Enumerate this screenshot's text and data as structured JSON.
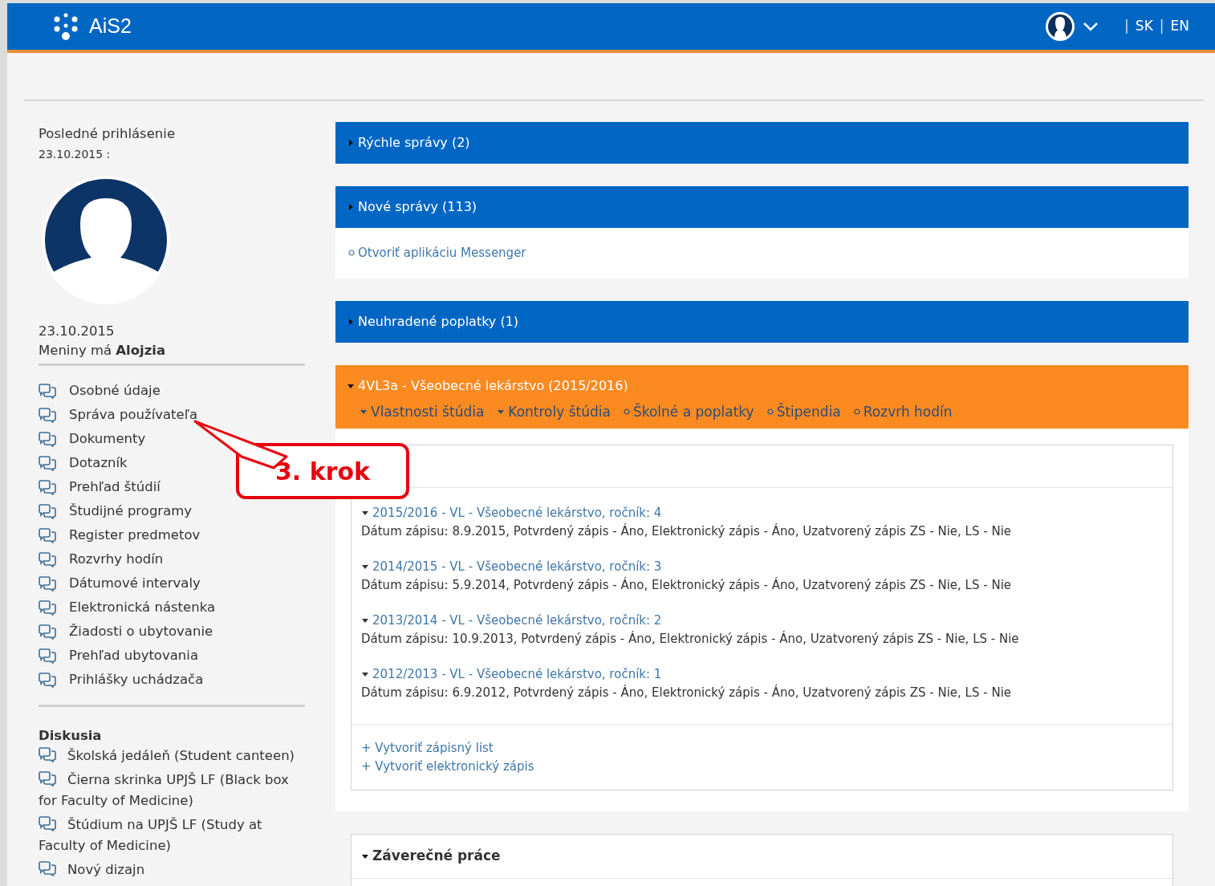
{
  "header": {
    "logo": "AiS2",
    "language_links": [
      {
        "separator": "|",
        "label": "SK"
      },
      {
        "separator": "|",
        "label": "EN"
      }
    ]
  },
  "sidebar": {
    "last_login_label": "Posledné prihlásenie",
    "last_login_date": "23.10.2015 :",
    "date": "23.10.2015",
    "nameday": "Meniny má **Alojzia**",
    "menu": [
      "Osobné údaje",
      "Správa používateľa",
      "Dokumenty",
      "Dotazník",
      "Prehľad štúdií",
      "Študijné programy",
      "Register predmetov",
      "Rozvrhy hodín",
      "Dátumové intervaly",
      "Elektronická nástenka",
      "Žiadosti o ubytovanie",
      "Prehľad ubytovania",
      "Prihlášky uchádzača"
    ],
    "discussion_title": "Diskusia",
    "discussions": [
      "Školská jedáleň (Student canteen)",
      "Čierna skrinka UPJŠ LF (Black box for Faculty of Medicine)",
      "Štúdium na UPJŠ LF (Study at Faculty of Medicine)",
      "Nový dizajn"
    ]
  },
  "panels": [
    {
      "kind": "info",
      "title": "Rýchle správy (2)",
      "expanded": false
    },
    {
      "kind": "info",
      "title": "Nové správy (113)",
      "expanded": false,
      "links": [
        "Otvoriť aplikáciu Messenger"
      ]
    },
    {
      "kind": "info",
      "title": "Neuhradené poplatky (1)",
      "expanded": false
    },
    {
      "kind": "study",
      "title": "4VL3a - Všeobecné lekárstvo (2015/2016)",
      "expanded": true,
      "tabs": [
        {
          "kind": "dropdown",
          "label": "Vlastnosti štúdia"
        },
        {
          "kind": "dropdown",
          "label": "Kontroly štúdia"
        },
        {
          "kind": "link",
          "label": "Školné a poplatky"
        },
        {
          "kind": "link",
          "label": "Štipendia"
        },
        {
          "kind": "link",
          "label": "Rozvrh hodín"
        }
      ],
      "enrollments": [
        {
          "title": "2015/2016 - VL - Všeobecné lekárstvo, ročník: 4",
          "expanded": true,
          "details": "Dátum zápisu: 8.9.2015, Potvrdený zápis - Áno, Elektronický zápis - Áno, Uzatvorený zápis ZS - Nie, LS - Nie"
        },
        {
          "title": "2014/2015 - VL - Všeobecné lekárstvo, ročník: 3",
          "expanded": true,
          "details": "Dátum zápisu: 5.9.2014, Potvrdený zápis - Áno, Elektronický zápis - Áno, Uzatvorený zápis ZS - Nie, LS - Nie"
        },
        {
          "title": "2013/2014 - VL - Všeobecné lekárstvo, ročník: 2",
          "expanded": true,
          "details": "Dátum zápisu: 10.9.2013, Potvrdený zápis - Áno, Elektronický zápis - Áno, Uzatvorený zápis ZS - Nie, LS - Nie"
        },
        {
          "title": "2012/2013 - VL - Všeobecné lekárstvo, ročník: 1",
          "expanded": true,
          "details": "Dátum zápisu: 6.9.2012, Potvrdený zápis - Áno, Elektronický zápis - Áno, Uzatvorený zápis ZS - Nie, LS - Nie"
        }
      ],
      "actions": [
        "+ Vytvoriť zápisný list",
        "+ Vytvoriť elektronický zápis"
      ]
    }
  ],
  "theses": {
    "title": "Záverečné práce",
    "expanded": true
  },
  "annotation": {
    "text": "3. krok"
  }
}
